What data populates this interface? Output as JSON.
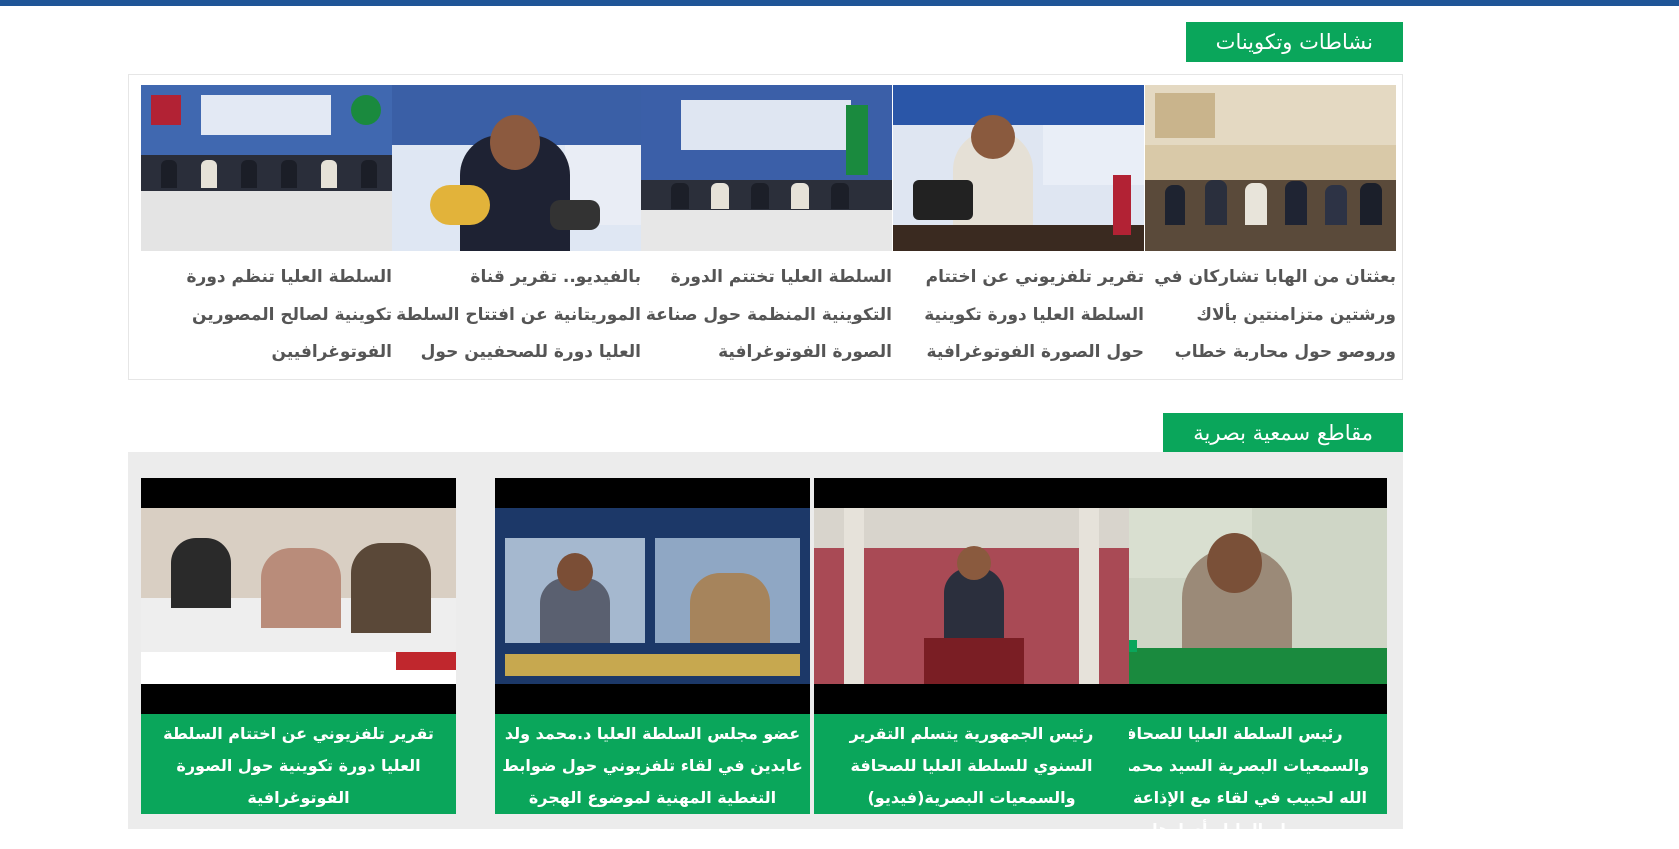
{
  "sections": {
    "activities": {
      "heading": "نشاطات وتكوينات",
      "items": [
        {
          "title": "بعثتان من الهابا تشاركان في ورشتين متزامنتين بألاك وروصو حول محاربة خطاب الكراهية"
        },
        {
          "title": "تقرير تلفزيوني عن اختتام السلطة العليا دورة تكوينية حول الصورة الفوتوغرافية"
        },
        {
          "title": "السلطة العليا تختتم الدورة التكوينية المنظمة حول صناعة الصورة الفوتوغرافية"
        },
        {
          "title": "بالفيديو.. تقرير قناة الموريتانية عن افتتاح السلطة العليا دورة للصحفيين حول الصورة الفوتوغرافية"
        },
        {
          "title": "السلطة العليا تنظم دورة تكوينية لصالح المصورين الفوتوغرافيين"
        }
      ]
    },
    "videos": {
      "heading": "مقاطع سمعية بصرية",
      "items": [
        {
          "title": "رئيس السلطة العليا للصحافة والسمعيات البصرية السيد محمد عبد الله لحبيب في لقاء مع الإذاعة حول مهام الهابا وأدوارها"
        },
        {
          "title": "رئيس الجمهورية يتسلم التقرير السنوي للسلطة العليا للصحافة والسمعيات البصرية(فيديو)"
        },
        {
          "title": "عضو مجلس السلطة العليا د.محمد ولد عابدين في لقاء تلفزيوني حول ضوابط التغطية المهنية لموضوع الهجرة"
        },
        {
          "title": "تقرير تلفزيوني عن اختتام السلطة العليا دورة تكوينية حول الصورة الفوتوغرافية"
        }
      ]
    }
  },
  "colors": {
    "accent_green": "#0aa65b",
    "top_bar_blue": "#1f5597",
    "video_panel_bg": "#ececec"
  }
}
